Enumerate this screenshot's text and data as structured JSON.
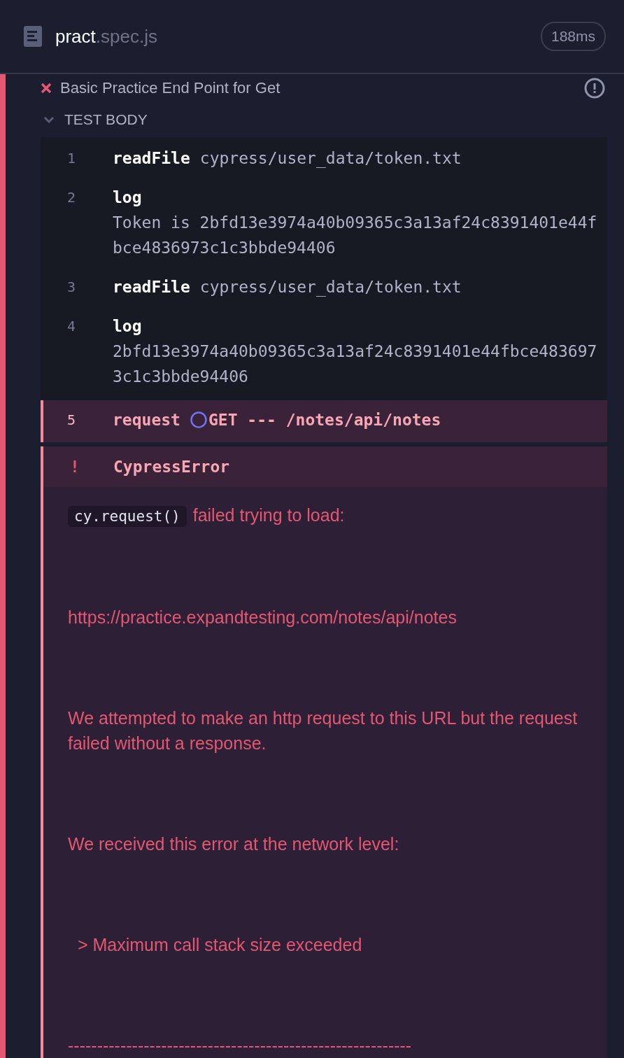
{
  "header": {
    "file_name": "pract",
    "file_ext": ".spec.js",
    "duration": "188ms"
  },
  "test": {
    "title": "Basic Practice End Point for Get",
    "failed": true
  },
  "section": {
    "label": "TEST BODY",
    "expanded": true
  },
  "commands": [
    {
      "number": "1",
      "name": "readFile",
      "message": "cypress/user_data/token.txt",
      "failed": false
    },
    {
      "number": "2",
      "name": "log",
      "message": "Token is 2bfd13e3974a40b09365c3a13af24c8391401e44fbce4836973c1c3bbde94406",
      "failed": false
    },
    {
      "number": "3",
      "name": "readFile",
      "message": "cypress/user_data/token.txt",
      "failed": false
    },
    {
      "number": "4",
      "name": "log",
      "message": "2bfd13e3974a40b09365c3a13af24c8391401e44fbce4836973c1c3bbde94406",
      "failed": false
    },
    {
      "number": "5",
      "name": "request",
      "message": "GET --- /notes/api/notes",
      "failed": true,
      "pending": true
    }
  ],
  "error": {
    "marker": "!",
    "name": "CypressError",
    "code": "cy.request()",
    "paragraphs": [
      "failed trying to load:",
      "https://practice.expandtesting.com/notes/api/notes",
      "We attempted to make an http request to this URL but the request failed without a response.",
      "We received this error at the network level:",
      "  > Maximum call stack size exceeded",
      "-----------------------------------------------------------"
    ]
  }
}
